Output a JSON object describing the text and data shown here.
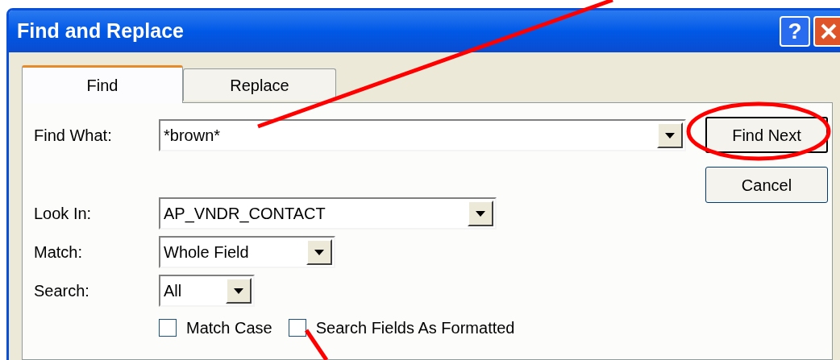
{
  "window": {
    "title": "Find and Replace",
    "help_button": "?"
  },
  "tabs": [
    {
      "label": "Find",
      "selected": true
    },
    {
      "label": "Replace",
      "selected": false
    }
  ],
  "fields": [
    {
      "label": "Find What:",
      "value": "*brown*"
    },
    {
      "label": "Look In:",
      "value": "AP_VNDR_CONTACT"
    },
    {
      "label": "Match:",
      "value": "Whole Field"
    },
    {
      "label": "Search:",
      "value": "All"
    }
  ],
  "buttons": [
    "Find Next",
    "Cancel"
  ],
  "checkboxes": [
    {
      "label": "Match Case",
      "checked": false
    },
    {
      "label": "Search Fields As Formatted",
      "checked": false
    }
  ]
}
